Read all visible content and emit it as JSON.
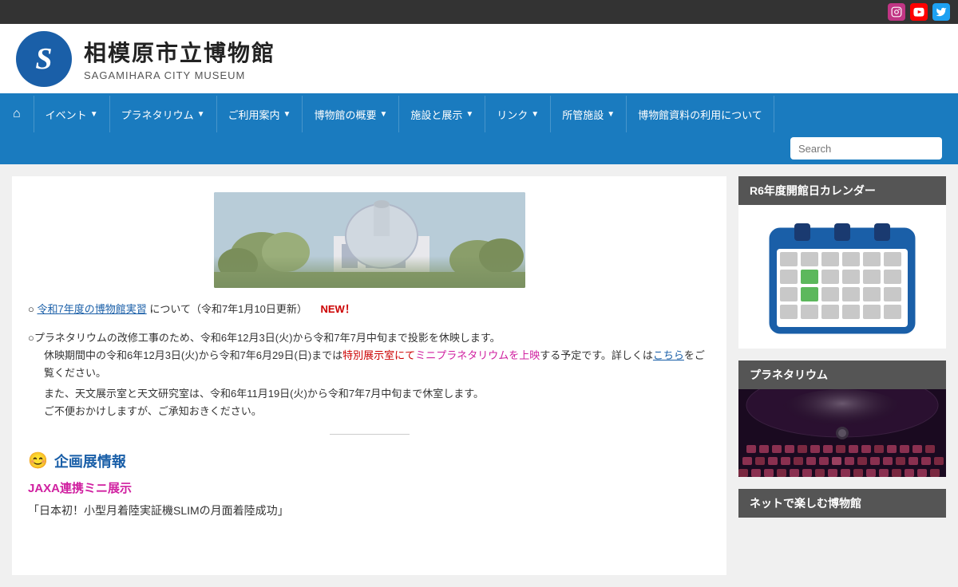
{
  "topbar": {
    "social": [
      {
        "name": "instagram",
        "label": "I",
        "class": "insta"
      },
      {
        "name": "youtube",
        "label": "▶",
        "class": "yt"
      },
      {
        "name": "twitter",
        "label": "t",
        "class": "tw"
      }
    ]
  },
  "header": {
    "logo_letter": "S",
    "title": "相模原市立博物館",
    "subtitle": "SAGAMIHARA CITY MUSEUM"
  },
  "nav": {
    "home_icon": "⌂",
    "items": [
      {
        "label": "イベント",
        "arrow": "▼"
      },
      {
        "label": "プラネタリウム",
        "arrow": "▼"
      },
      {
        "label": "ご利用案内",
        "arrow": "▼"
      },
      {
        "label": "博物館の概要",
        "arrow": "▼"
      },
      {
        "label": "施設と展示",
        "arrow": "▼"
      },
      {
        "label": "リンク",
        "arrow": "▼"
      },
      {
        "label": "所管施設",
        "arrow": "▼"
      },
      {
        "label": "博物館資料の利用について"
      }
    ]
  },
  "search": {
    "placeholder": "Search"
  },
  "content": {
    "news_items": [
      {
        "prefix": "○",
        "link_text": "令和7年度の博物館実習",
        "text": "について（令和7年1月10日更新）",
        "badge": "NEW！"
      },
      {
        "text": "○プラネタリウムの改修工事のため、令和6年12月3日(火)から令和7年7月中旬まで投影を休映します。",
        "indent1": "休映期間中の令和6年12月3日(火)から令和7年6月29日(日)までは",
        "special_text": "特別展示室にて",
        "pink_text": "ミニプラネタリウムを上映",
        "after_text": "する予定です。詳しくは",
        "link_text": "こちら",
        "after_link": "をご覧ください。",
        "indent2": "また、天文展示室と天文研究室は、令和6年11月19日(火)から令和7年7月中旬まで休室します。",
        "indent3": "ご不便おかけしますが、ご承知おきください。"
      }
    ],
    "section_icon": "😊",
    "section_title": "企画展情報",
    "exhibit_title": "JAXA連携ミニ展示",
    "exhibit_subtitle": "「日本初！小型月着陸実証機SLIMの月面着陸成功」"
  },
  "sidebar": {
    "calendar_header": "R6年度開館日カレンダー",
    "planetarium_header": "プラネタリウム",
    "net_header": "ネットで楽しむ博物館"
  }
}
